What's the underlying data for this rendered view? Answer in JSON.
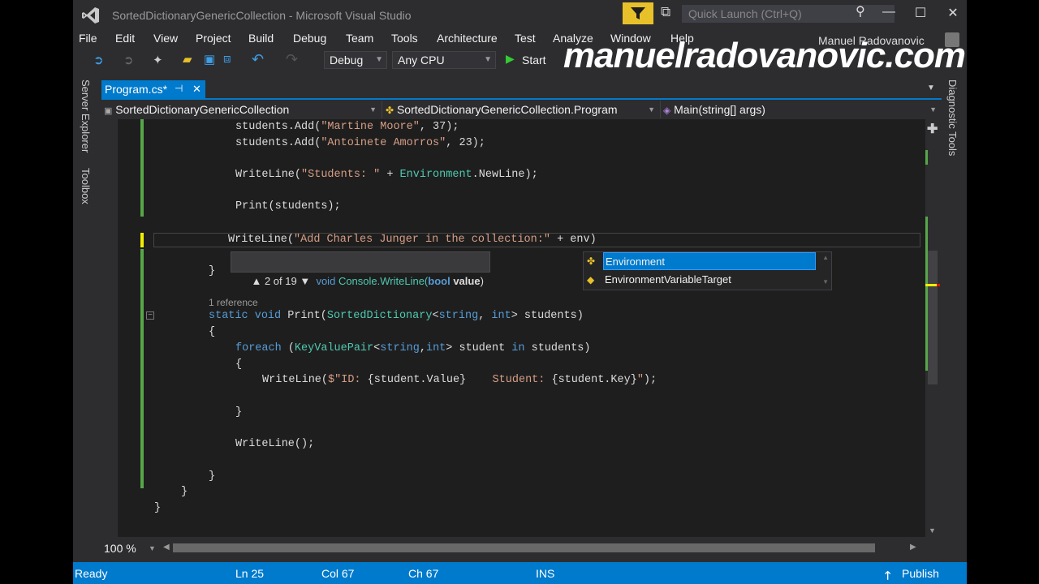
{
  "window": {
    "title": "SortedDictionaryGenericCollection - Microsoft Visual Studio",
    "quick_launch_placeholder": "Quick Launch (Ctrl+Q)",
    "user_name": "Manuel Radovanovic",
    "watermark": "manuelradovanovic.com"
  },
  "menu": [
    "File",
    "Edit",
    "View",
    "Project",
    "Build",
    "Debug",
    "Team",
    "Tools",
    "Architecture",
    "Test",
    "Analyze",
    "Window",
    "Help"
  ],
  "toolbar": {
    "config": "Debug",
    "platform": "Any CPU",
    "start_label": "Start"
  },
  "side_tabs": {
    "left": [
      "Server Explorer",
      "Toolbox"
    ],
    "right": [
      "Diagnostic Tools"
    ]
  },
  "document_tab": {
    "label": "Program.cs*",
    "pin": "⊣",
    "close": "✕"
  },
  "nav_bar": {
    "project": "SortedDictionaryGenericCollection",
    "class": "SortedDictionaryGenericCollection.Program",
    "member": "Main(string[] args)"
  },
  "code": {
    "line1": {
      "pre": "students.Add(",
      "str": "\"Martine Moore\"",
      "post": ", 37);"
    },
    "line2": {
      "pre": "students.Add(",
      "str": "\"Antoinete Amorros\"",
      "post": ", 23);"
    },
    "line3": {
      "pre": "WriteLine(",
      "str": "\"Students: \"",
      "mid": " + ",
      "ty": "Environment",
      "post": ".NewLine);"
    },
    "line4": "Print(students);",
    "line5": {
      "pre": "WriteLine(",
      "str": "\"Add Charles Junger in the collection:\"",
      "post": " + env)"
    },
    "line6": "}",
    "references": "1 reference",
    "line7": {
      "kw1": "static",
      "kw2": "void",
      "name": " Print(",
      "ty": "SortedDictionary",
      "lt": "<",
      "kw3": "string",
      "comma": ", ",
      "kw4": "int",
      "post": "> students)"
    },
    "line8": "{",
    "line9": {
      "kw": "foreach",
      "pre": " (",
      "ty": "KeyValuePair",
      "lt": "<",
      "kw2": "string",
      "comma": ",",
      "kw3": "int",
      "post": "> student ",
      "kw4": "in",
      "post2": " students)"
    },
    "line10": "{",
    "line11": {
      "pre": "WriteLine(",
      "str1": "$\"ID: ",
      "interp1": "{student.Value}",
      "str2": "    Student: ",
      "interp2": "{student.Key}",
      "str3": "\"",
      "post": ");"
    },
    "line12": "}",
    "line13": "WriteLine();",
    "line14": "}",
    "line15": "}",
    "line16": "}"
  },
  "signature_help": {
    "counter": "2 of 19",
    "ret": "void",
    "method": "Console.WriteLine(",
    "param_type": "bool",
    "param_name": "value",
    "close": ")"
  },
  "completion": {
    "items": [
      "Environment",
      "EnvironmentVariableTarget"
    ],
    "selected_index": 0
  },
  "zoom": "100 %",
  "status": {
    "state": "Ready",
    "ln": "Ln 25",
    "col": "Col 67",
    "ch": "Ch 67",
    "mode": "INS",
    "publish": "Publish"
  },
  "colors": {
    "accent": "#007acc",
    "bg": "#2d2d30",
    "editor": "#1e1e1e"
  }
}
